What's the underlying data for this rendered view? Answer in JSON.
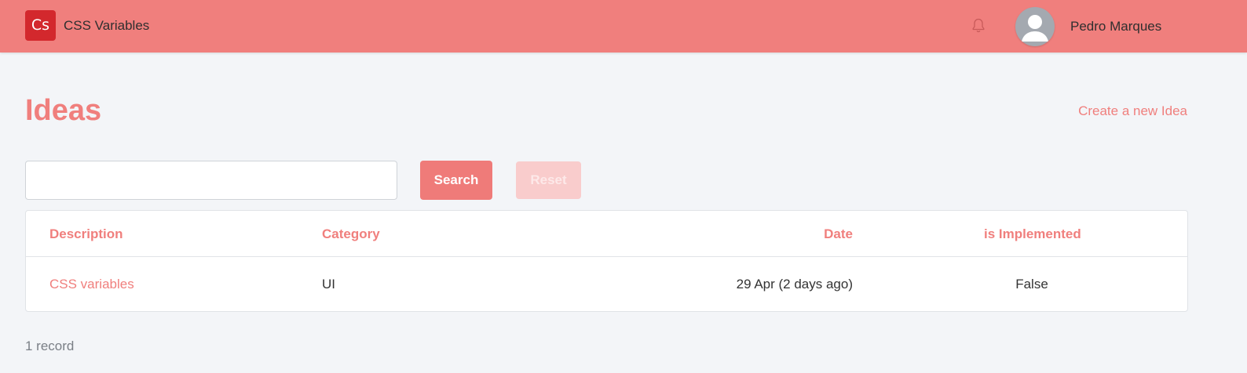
{
  "navbar": {
    "logo_text": "Cs",
    "app_name": "CSS Variables",
    "user_name": "Pedro Marques",
    "icons": {
      "bell": "bell-icon",
      "avatar": "user-avatar-icon"
    },
    "colors": {
      "bar": "#f07f7d",
      "logo": "#d3282d"
    }
  },
  "page": {
    "title": "Ideas",
    "create_link": "Create a new Idea"
  },
  "search": {
    "value": "",
    "placeholder": "",
    "search_label": "Search",
    "reset_label": "Reset"
  },
  "table": {
    "headers": {
      "description": "Description",
      "category": "Category",
      "date": "Date",
      "implemented": "is Implemented"
    },
    "rows": [
      {
        "description": "CSS variables",
        "category": "UI",
        "date": "29 Apr (2 days ago)",
        "implemented": "False"
      }
    ]
  },
  "footer": {
    "record_count": "1 record"
  },
  "colors": {
    "accent": "#f07f7d",
    "background": "#f3f5f8",
    "reset_disabled": "#f9cccc"
  }
}
